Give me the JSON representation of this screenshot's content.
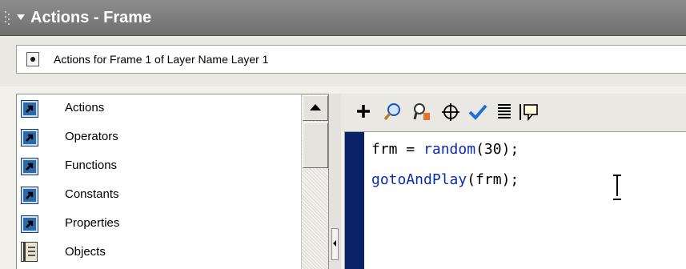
{
  "panel": {
    "title": "Actions - Frame"
  },
  "frame_info": {
    "label": "Actions for Frame 1 of Layer Name Layer 1"
  },
  "toolbox": {
    "items": [
      {
        "label": "Actions",
        "icon": "book-icon"
      },
      {
        "label": "Operators",
        "icon": "book-icon"
      },
      {
        "label": "Functions",
        "icon": "book-icon"
      },
      {
        "label": "Constants",
        "icon": "book-icon"
      },
      {
        "label": "Properties",
        "icon": "book-icon"
      },
      {
        "label": "Objects",
        "icon": "objects-book-icon"
      }
    ]
  },
  "script_toolbar": {
    "tools": [
      "add-action-icon",
      "find-icon",
      "replace-icon",
      "insert-target-path-icon",
      "check-syntax-icon",
      "auto-format-icon",
      "show-code-hint-icon"
    ]
  },
  "script": {
    "lines": [
      {
        "keyword": "frm",
        "rest": " = ",
        "call": "random",
        "args": "(30);"
      },
      {
        "keyword": "gotoAndPlay",
        "rest": "(frm);"
      }
    ]
  },
  "colors": {
    "title_bar": "#7f7f7f",
    "gutter": "#0a2268",
    "keyword": "#0a2bb5",
    "book_icon": "#2f67a8"
  }
}
